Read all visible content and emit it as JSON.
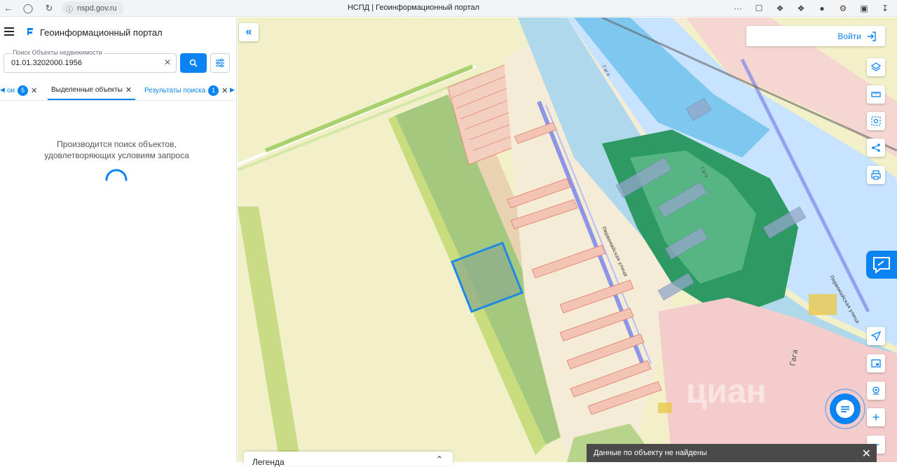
{
  "browser": {
    "url": "nspd.gov.ru",
    "tab_title": "НСПД | Геоинформационный портал",
    "more": "···"
  },
  "sidebar": {
    "title": "Геоинформационный портал",
    "search": {
      "label": "Поиск Объекты недвижимости",
      "value": "01.01.3202000.1956"
    },
    "tabs": [
      {
        "label": "ои",
        "badge": "5"
      },
      {
        "label": "Выделенные объекты"
      },
      {
        "label": "Результаты поиска",
        "badge": "1"
      }
    ],
    "loading_line1": "Производится поиск объектов,",
    "loading_line2": "удовлетворяющих условиям запроса"
  },
  "map": {
    "login_label": "Войти",
    "legend_title": "Легенда",
    "toast_message": "Данные по объекту не найдены",
    "street_label_1": "Первомайская улица",
    "street_label_2": "Первомайская улица",
    "river_label_1": "Гага",
    "river_label_2": "Гага",
    "river_label_3": "Гага",
    "watermark": "циан",
    "colors": {
      "accent": "#0b84f3",
      "water": "#bcd9f7",
      "green_zone": "#2e9a63",
      "parcel_fill": "#f3c3b4",
      "selected_parcel": "#1e88e5"
    }
  }
}
